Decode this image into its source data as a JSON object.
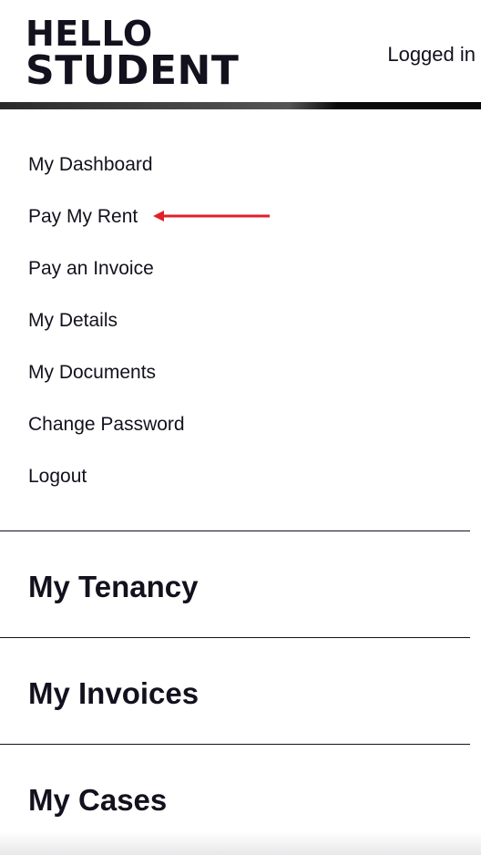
{
  "header": {
    "logo_line1": "HELLO",
    "logo_line2": "STUDENT",
    "logged_in_label": "Logged in"
  },
  "nav": {
    "items": [
      {
        "label": "My Dashboard"
      },
      {
        "label": "Pay My Rent"
      },
      {
        "label": "Pay an Invoice"
      },
      {
        "label": "My Details"
      },
      {
        "label": "My Documents"
      },
      {
        "label": "Change Password"
      },
      {
        "label": "Logout"
      }
    ]
  },
  "sections": [
    {
      "title": "My Tenancy"
    },
    {
      "title": "My Invoices"
    },
    {
      "title": "My Cases"
    }
  ],
  "colors": {
    "text": "#14111e",
    "arrow": "#e0202b"
  },
  "icons": {
    "annotation": "red-arrow-icon"
  }
}
